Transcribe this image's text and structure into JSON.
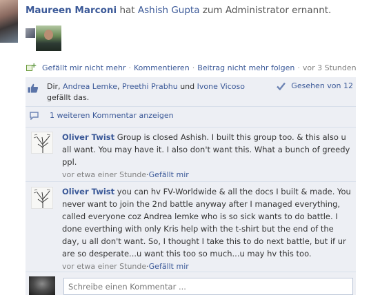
{
  "story": {
    "actor": "Maureen Marconi",
    "verb_text": "hat",
    "target": "Ashish Gupta",
    "tail_text": "zum Administrator ernannt."
  },
  "actions": {
    "unlike": "Gefällt mir nicht mehr",
    "comment": "Kommentieren",
    "unfollow": "Beitrag nicht mehr folgen",
    "time": "vor 3 Stunden",
    "separator": "·"
  },
  "likes": {
    "prefix": "Dir, ",
    "people": [
      "Andrea Lemke",
      "Preethi Prabhu",
      "Ivone Vicoso"
    ],
    "comma": ", ",
    "and": " und ",
    "suffix": "gefällt das.",
    "seen_by": "Gesehen von 12"
  },
  "more_comments": "1 weiteren Kommentar anzeigen",
  "comments": [
    {
      "author": "Oliver Twist",
      "text": "Group is closed Ashish. I built this group too. & this also u all want. You may have it. I also don't want this. What a bunch of greedy ppl.",
      "time": "vor etwa einer Stunde",
      "like": "Gefällt mir"
    },
    {
      "author": "Oliver Twist",
      "text": "you can hv FV-Worldwide & all the docs I built & made. You never want to join the 2nd battle anyway after I managed everything, called everyone coz Andrea lemke who is so sick wants to do battle. I done everthing with only Kris help with the t-shirt but the end of the day, u all don't want. So, I thought I take this to do next battle, but if ur are so desperate...u want this too so much...u may hv this too.",
      "time": "vor etwa einer Stunde",
      "like": "Gefällt mir"
    }
  ],
  "composer": {
    "placeholder": "Schreibe einen Kommentar ..."
  },
  "colors": {
    "link": "#3b5998",
    "panel": "#edeff4",
    "divider": "#d8dfea"
  }
}
